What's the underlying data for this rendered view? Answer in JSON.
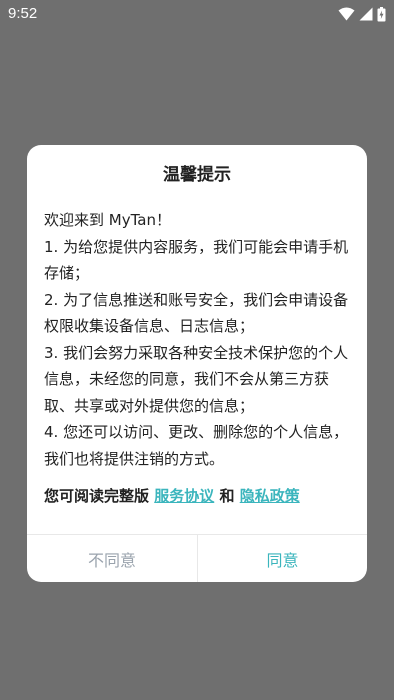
{
  "status_bar": {
    "time": "9:52",
    "icons": [
      "wifi-icon",
      "cellular-signal-icon",
      "battery-charging-icon"
    ]
  },
  "dialog": {
    "title": "温馨提示",
    "paragraphs": [
      "欢迎来到 MyTan！",
      " 1. 为给您提供内容服务，我们可能会申请手机存储；",
      " 2. 为了信息推送和账号安全，我们会申请设备权限收集设备信息、日志信息；",
      " 3. 我们会努力采取各种安全技术保护您的个人信息，未经您的同意，我们不会从第三方获取、共享或对外提供您的信息；",
      " 4. 您还可以访问、更改、删除您的个人信息，我们也将提供注销的方式。"
    ],
    "policy_prefix": "您可阅读完整版 ",
    "service_agreement": "服务协议",
    "policy_joiner": " 和 ",
    "privacy_policy": "隐私政策",
    "disagree_label": "不同意",
    "agree_label": "同意"
  },
  "colors": {
    "backdrop": "#6f6f6f",
    "accent": "#3bb5bd",
    "muted_button": "#9aa3ad",
    "text": "#222222"
  }
}
